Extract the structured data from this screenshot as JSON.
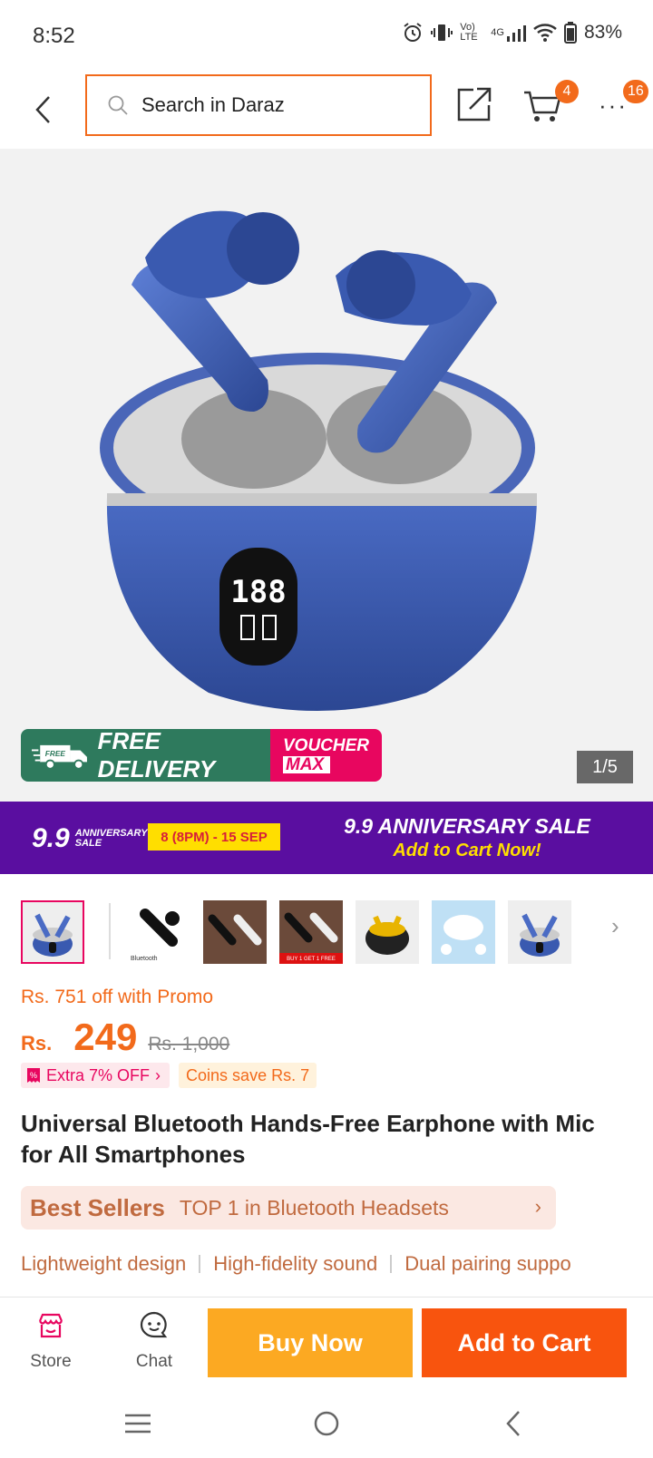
{
  "status_bar": {
    "time": "8:52",
    "network": "4G",
    "lte": "Vo) LTE",
    "battery": "83%"
  },
  "header": {
    "search_placeholder": "Search in Daraz",
    "cart_count": "4",
    "more_count": "16"
  },
  "gallery": {
    "free_delivery": "FREE DELIVERY",
    "free_label": "FREE",
    "voucher_line1": "VOUCHER",
    "voucher_line2": "MAX",
    "counter": "1/5"
  },
  "sale_banner": {
    "badge_number": "9.9",
    "badge_text": "ANNIVERSARY SALE",
    "dates": "8 (8PM) - 15 SEP",
    "headline": "9.9 ANNIVERSARY SALE",
    "subline": "Add to Cart Now!"
  },
  "thumbnails": {
    "count": 7,
    "selected_index": 0,
    "labels": [
      "",
      "Bluetooth",
      "",
      "BUY 1 GET 1 FREE",
      "",
      "",
      ""
    ]
  },
  "price": {
    "promo_text": "Rs. 751 off with Promo",
    "currency": "Rs.",
    "current": "249",
    "original": "Rs. 1,000",
    "extra_off": "Extra 7% OFF",
    "coins_save": "Coins save Rs. 7"
  },
  "product": {
    "title": "Universal Bluetooth Hands-Free Earphone with Mic for All Smartphones"
  },
  "best_sellers": {
    "label": "Best Sellers",
    "rank_text": "TOP 1 in Bluetooth Headsets"
  },
  "features": [
    "Lightweight design",
    "High-fidelity sound",
    "Dual pairing suppo"
  ],
  "bottom_bar": {
    "store_label": "Store",
    "chat_label": "Chat",
    "buy_now": "Buy Now",
    "add_to_cart": "Add to Cart"
  },
  "colors": {
    "brand_orange": "#f26a1b",
    "buy_now": "#fca922",
    "add_to_cart": "#f8540e",
    "sale_purple": "#5a0ea0",
    "voucher_pink": "#e8065f"
  }
}
